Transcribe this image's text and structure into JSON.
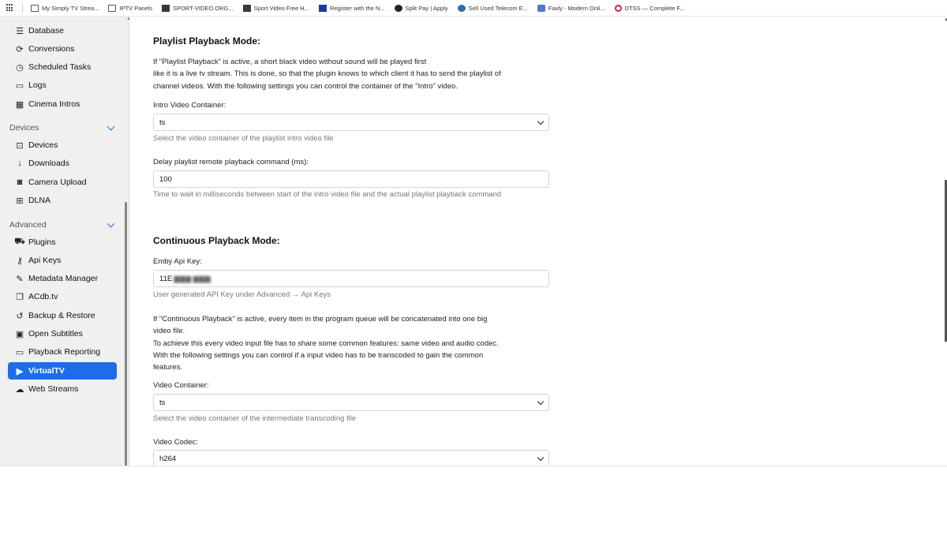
{
  "bookmarks": [
    {
      "label": "My Simply TV Strea...",
      "icon": "folder-icon"
    },
    {
      "label": "IPTV Panels",
      "icon": "folder-icon"
    },
    {
      "label": "SPORT-VIDEO.ORG...",
      "icon": "site-icon"
    },
    {
      "label": "Sport Video Free H...",
      "icon": "site-icon"
    },
    {
      "label": "Register with the N...",
      "icon": "site-icon"
    },
    {
      "label": "Split Pay | Apply",
      "icon": "site-icon"
    },
    {
      "label": "Sell Used Telecom E...",
      "icon": "wordpress-icon"
    },
    {
      "label": "Faxly - Modern Onli...",
      "icon": "site-icon"
    },
    {
      "label": "DTSS — Complete F...",
      "icon": "site-icon"
    }
  ],
  "sidebar": {
    "items_top": [
      {
        "label": "Database",
        "icon": "database-icon"
      },
      {
        "label": "Conversions",
        "icon": "conversions-icon"
      },
      {
        "label": "Scheduled Tasks",
        "icon": "clock-icon"
      },
      {
        "label": "Logs",
        "icon": "folder-open-icon"
      },
      {
        "label": "Cinema Intros",
        "icon": "film-icon"
      }
    ],
    "section_devices": "Devices",
    "items_devices": [
      {
        "label": "Devices",
        "icon": "devices-icon"
      },
      {
        "label": "Downloads",
        "icon": "download-icon"
      },
      {
        "label": "Camera Upload",
        "icon": "camera-icon"
      },
      {
        "label": "DLNA",
        "icon": "dlna-icon"
      }
    ],
    "section_advanced": "Advanced",
    "items_advanced": [
      {
        "label": "Plugins",
        "icon": "cart-icon"
      },
      {
        "label": "Api Keys",
        "icon": "key-icon"
      },
      {
        "label": "Metadata Manager",
        "icon": "pencil-icon"
      },
      {
        "label": "ACdb.tv",
        "icon": "copy-icon"
      },
      {
        "label": "Backup & Restore",
        "icon": "restore-icon"
      },
      {
        "label": "Open Subtitles",
        "icon": "subtitles-icon"
      },
      {
        "label": "Playback Reporting",
        "icon": "folder-icon"
      },
      {
        "label": "VirtualTV",
        "icon": "play-icon"
      },
      {
        "label": "Web Streams",
        "icon": "cloud-icon"
      }
    ],
    "active_item": "VirtualTV"
  },
  "main": {
    "playlist_heading": "Playlist Playback Mode:",
    "playlist_desc": [
      "If \"Playlist Playback\" is active, a short black video without sound will be played first",
      "like it is a live tv stream. This is done, so that the plugin knows to which client it has to send the playlist of",
      "channel videos. With the following settings you can control the container of the \"Intro\" video."
    ],
    "intro_container_label": "Intro Video Container:",
    "intro_container_value": "ts",
    "intro_container_help": "Select the video container of the playlist intro video file",
    "delay_label": "Delay playlist remote playback command (ms):",
    "delay_value": "100",
    "delay_help": "Time to wait in milliseconds between start of the intro video file and the actual playlist playback command",
    "continuous_heading": "Continuous Playback Mode:",
    "api_key_label": "Emby Api Key:",
    "api_key_value": "11E",
    "api_key_help": "User generated API Key under Advanced → Api Keys",
    "continuous_desc": [
      "If \"Continuous Playback\" is active, every item in the program queue will be concatenated into one big",
      "video file.",
      "To achieve this every video input file has to share some common features: same video and audio codec.",
      "With the following settings you can control if a input video has to be transcoded to gain the common",
      "features."
    ],
    "video_container_label": "Video Container:",
    "video_container_value": "ts",
    "video_container_help": "Select the video container of the intermediate transcoding file",
    "video_codec_label": "Video Codec:",
    "video_codec_value": "h264"
  },
  "colors": {
    "accent": "#1b6ee8",
    "sidebar_bg": "#f0f0f0"
  }
}
